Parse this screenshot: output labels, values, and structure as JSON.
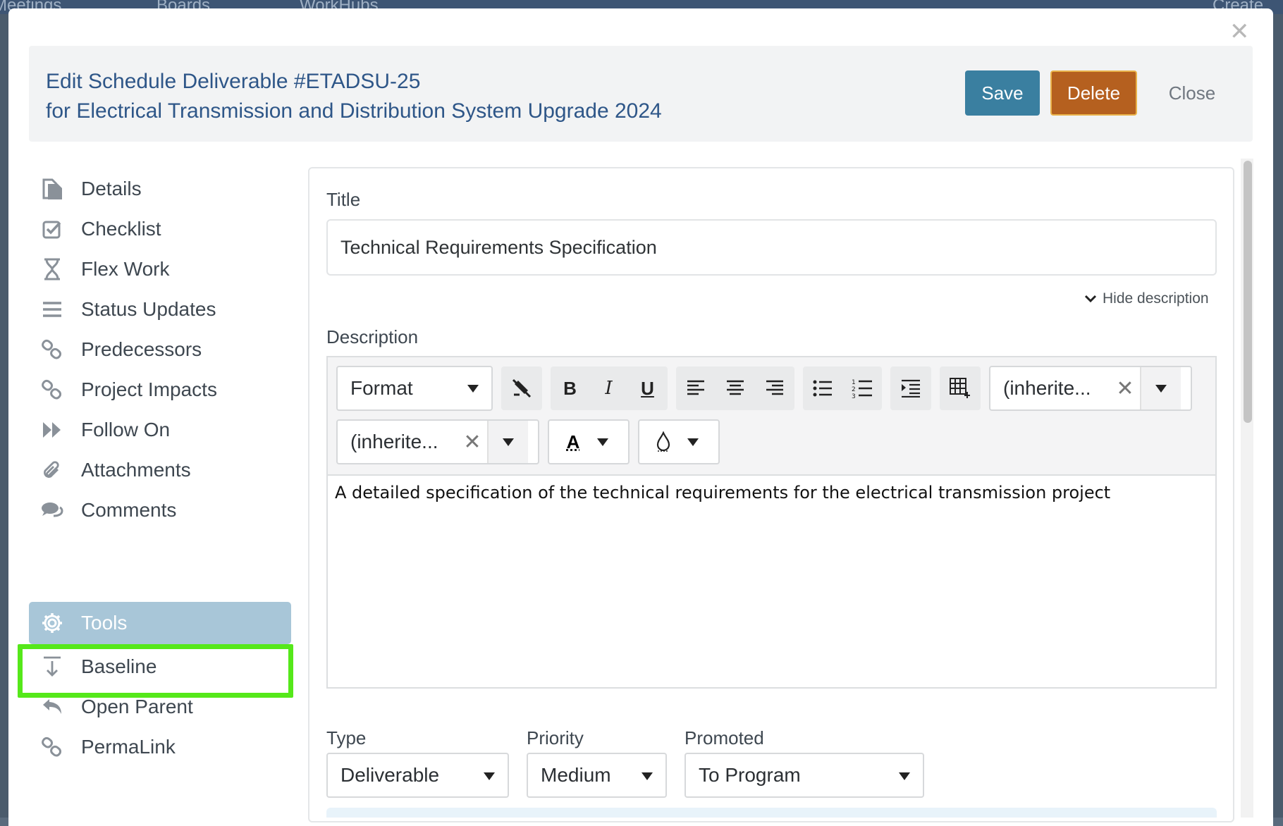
{
  "backdrop": {
    "nav_items": [
      "Meetings",
      "Boards",
      "WorkHubs",
      "Create"
    ]
  },
  "header": {
    "title_line1": "Edit Schedule Deliverable #ETADSU-25",
    "title_line2": "for Electrical Transmission and Distribution System Upgrade 2024",
    "save_label": "Save",
    "delete_label": "Delete",
    "close_label": "Close"
  },
  "sidebar": {
    "items": [
      {
        "label": "Details",
        "icon": "document-icon"
      },
      {
        "label": "Checklist",
        "icon": "checkbox-icon"
      },
      {
        "label": "Flex Work",
        "icon": "hourglass-icon"
      },
      {
        "label": "Status Updates",
        "icon": "list-icon"
      },
      {
        "label": "Predecessors",
        "icon": "link-icon"
      },
      {
        "label": "Project Impacts",
        "icon": "link-icon"
      },
      {
        "label": "Follow On",
        "icon": "fast-forward-icon"
      },
      {
        "label": "Attachments",
        "icon": "paperclip-icon"
      },
      {
        "label": "Comments",
        "icon": "comments-icon"
      },
      {
        "label": "Tools",
        "icon": "gear-icon"
      },
      {
        "label": "Baseline",
        "icon": "download-icon"
      },
      {
        "label": "Open Parent",
        "icon": "reply-icon"
      },
      {
        "label": "PermaLink",
        "icon": "link-icon"
      }
    ]
  },
  "form": {
    "title_label": "Title",
    "title_value": "Technical Requirements Specification",
    "hide_description": "Hide description",
    "description_label": "Description",
    "description_text": "A detailed specification of the technical requirements for the electrical transmission project",
    "toolbar": {
      "format_label": "Format",
      "font_family_value": "(inherite...",
      "font_size_value": "(inherite..."
    },
    "type_label": "Type",
    "type_value": "Deliverable",
    "priority_label": "Priority",
    "priority_value": "Medium",
    "promoted_label": "Promoted",
    "promoted_value": "To Program"
  },
  "colors": {
    "accent": "#3a7fa0",
    "delete": "#b5601f",
    "title_text": "#2e5688",
    "tools_active": "#a8c6d8",
    "highlight": "#55e81a"
  }
}
